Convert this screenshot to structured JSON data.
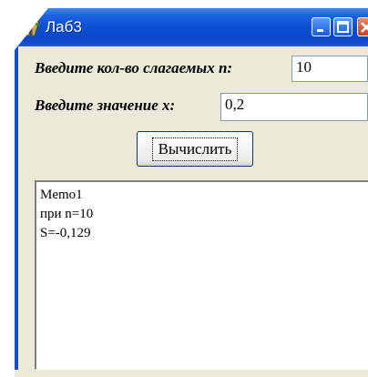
{
  "window": {
    "title": "Лаб3",
    "icon": "delphi-app-icon"
  },
  "title_buttons": {
    "minimize": "minimize-icon",
    "maximize": "maximize-icon",
    "close": "close-icon"
  },
  "form": {
    "n_label": "Введите кол-во слагаемых n:",
    "n_value": "10",
    "x_label": "Введите значение x:",
    "x_value": "0,2",
    "calc_button": "Вычислить"
  },
  "memo": {
    "lines": [
      "Memo1",
      "при n=10",
      "S=-0,129"
    ]
  },
  "colors": {
    "titlebar": "#0b4fd6",
    "window_bg": "#ece9d8",
    "edit_border": "#7f9db9"
  }
}
